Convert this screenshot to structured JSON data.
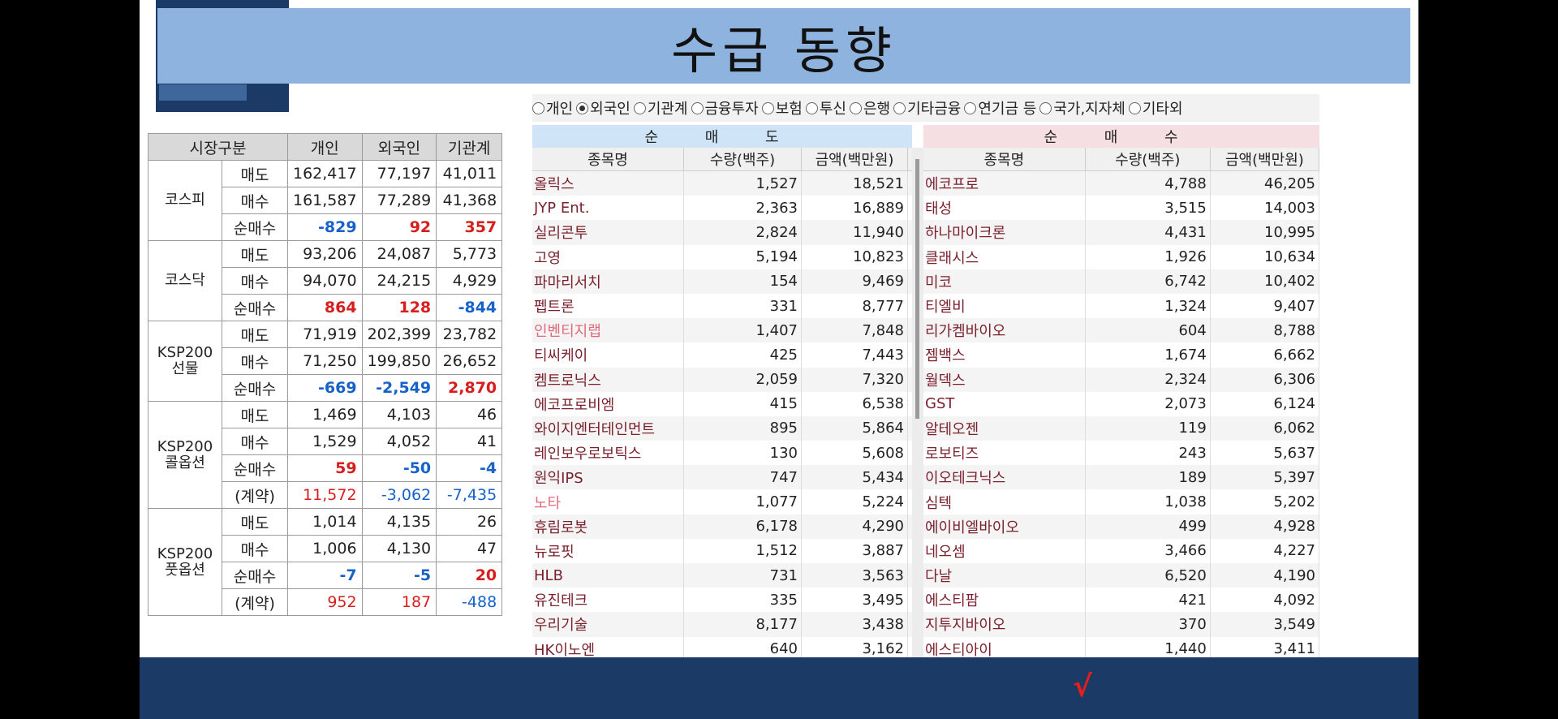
{
  "title": "수급 동향",
  "left_table": {
    "headers": [
      "시장구분",
      "개인",
      "외국인",
      "기관계"
    ],
    "groups": [
      {
        "market": "코스피",
        "rows": [
          {
            "label": "매도",
            "values": [
              "162,417",
              "77,197",
              "41,011"
            ]
          },
          {
            "label": "매수",
            "values": [
              "161,587",
              "77,289",
              "41,368"
            ]
          },
          {
            "label": "순매수",
            "values": [
              "-829",
              "92",
              "357"
            ]
          }
        ]
      },
      {
        "market": "코스닥",
        "rows": [
          {
            "label": "매도",
            "values": [
              "93,206",
              "24,087",
              "5,773"
            ]
          },
          {
            "label": "매수",
            "values": [
              "94,070",
              "24,215",
              "4,929"
            ]
          },
          {
            "label": "순매수",
            "values": [
              "864",
              "128",
              "-844"
            ]
          }
        ]
      },
      {
        "market": "KSP200 선물",
        "rows": [
          {
            "label": "매도",
            "values": [
              "71,919",
              "202,399",
              "23,782"
            ]
          },
          {
            "label": "매수",
            "values": [
              "71,250",
              "199,850",
              "26,652"
            ]
          },
          {
            "label": "순매수",
            "values": [
              "-669",
              "-2,549",
              "2,870"
            ]
          }
        ]
      },
      {
        "market": "KSP200 콜옵션",
        "rows": [
          {
            "label": "매도",
            "values": [
              "1,469",
              "4,103",
              "46"
            ]
          },
          {
            "label": "매수",
            "values": [
              "1,529",
              "4,052",
              "41"
            ]
          },
          {
            "label": "순매수",
            "values": [
              "59",
              "-50",
              "-4"
            ]
          },
          {
            "label": "(계약)",
            "values": [
              "11,572",
              "-3,062",
              "-7,435"
            ]
          }
        ]
      },
      {
        "market": "KSP200 풋옵션",
        "rows": [
          {
            "label": "매도",
            "values": [
              "1,014",
              "4,135",
              "26"
            ]
          },
          {
            "label": "매수",
            "values": [
              "1,006",
              "4,130",
              "47"
            ]
          },
          {
            "label": "순매수",
            "values": [
              "-7",
              "-5",
              "20"
            ]
          },
          {
            "label": "(계약)",
            "values": [
              "952",
              "187",
              "-488"
            ]
          }
        ]
      }
    ]
  },
  "radio_options": [
    "개인",
    "외국인",
    "기관계",
    "금융투자",
    "보험",
    "투신",
    "은행",
    "기타금융",
    "연기금 등",
    "국가,지자체",
    "기타외"
  ],
  "radio_selected": "외국인",
  "sell_panel": {
    "title": "순 매 도",
    "columns": [
      "종목명",
      "수량(백주)",
      "금액(백만원)"
    ],
    "rows": [
      [
        "올릭스",
        "1,527",
        "18,521"
      ],
      [
        "JYP Ent.",
        "2,363",
        "16,889"
      ],
      [
        "실리콘투",
        "2,824",
        "11,940"
      ],
      [
        "고영",
        "5,194",
        "10,823"
      ],
      [
        "파마리서치",
        "154",
        "9,469"
      ],
      [
        "펩트론",
        "331",
        "8,777"
      ],
      [
        "인벤티지랩",
        "1,407",
        "7,848"
      ],
      [
        "티씨케이",
        "425",
        "7,443"
      ],
      [
        "켐트로닉스",
        "2,059",
        "7,320"
      ],
      [
        "에코프로비엠",
        "415",
        "6,538"
      ],
      [
        "와이지엔터테인먼트",
        "895",
        "5,864"
      ],
      [
        "레인보우로보틱스",
        "130",
        "5,608"
      ],
      [
        "원익IPS",
        "747",
        "5,434"
      ],
      [
        "노타",
        "1,077",
        "5,224"
      ],
      [
        "휴림로봇",
        "6,178",
        "4,290"
      ],
      [
        "뉴로핏",
        "1,512",
        "3,887"
      ],
      [
        "HLB",
        "731",
        "3,563"
      ],
      [
        "유진테크",
        "335",
        "3,495"
      ],
      [
        "우리기술",
        "8,177",
        "3,438"
      ],
      [
        "HK이노엔",
        "640",
        "3,162"
      ]
    ]
  },
  "buy_panel": {
    "title": "순 매 수",
    "columns": [
      "종목명",
      "수량(백주)",
      "금액(백만원)"
    ],
    "rows": [
      [
        "에코프로",
        "4,788",
        "46,205"
      ],
      [
        "태성",
        "3,515",
        "14,003"
      ],
      [
        "하나마이크론",
        "4,431",
        "10,995"
      ],
      [
        "클래시스",
        "1,926",
        "10,634"
      ],
      [
        "미코",
        "6,742",
        "10,402"
      ],
      [
        "티엘비",
        "1,324",
        "9,407"
      ],
      [
        "리가켐바이오",
        "604",
        "8,788"
      ],
      [
        "젬백스",
        "1,674",
        "6,662"
      ],
      [
        "월덱스",
        "2,324",
        "6,306"
      ],
      [
        "GST",
        "2,073",
        "6,124"
      ],
      [
        "알테오젠",
        "119",
        "6,062"
      ],
      [
        "로보티즈",
        "243",
        "5,637"
      ],
      [
        "이오테크닉스",
        "189",
        "5,397"
      ],
      [
        "심텍",
        "1,038",
        "5,202"
      ],
      [
        "에이비엘바이오",
        "499",
        "4,928"
      ],
      [
        "네오셈",
        "3,466",
        "4,227"
      ],
      [
        "다날",
        "6,520",
        "4,190"
      ],
      [
        "에스티팜",
        "421",
        "4,092"
      ],
      [
        "지투지바이오",
        "370",
        "3,549"
      ],
      [
        "에스티아이",
        "1,440",
        "3,411"
      ]
    ]
  },
  "checkmark": "√",
  "colors": {
    "title_bar": "#8eb3de",
    "navy": "#1b3a66",
    "positive": "#d81d1d",
    "negative": "#1662c8",
    "stock_name": "#7a1f2b"
  }
}
